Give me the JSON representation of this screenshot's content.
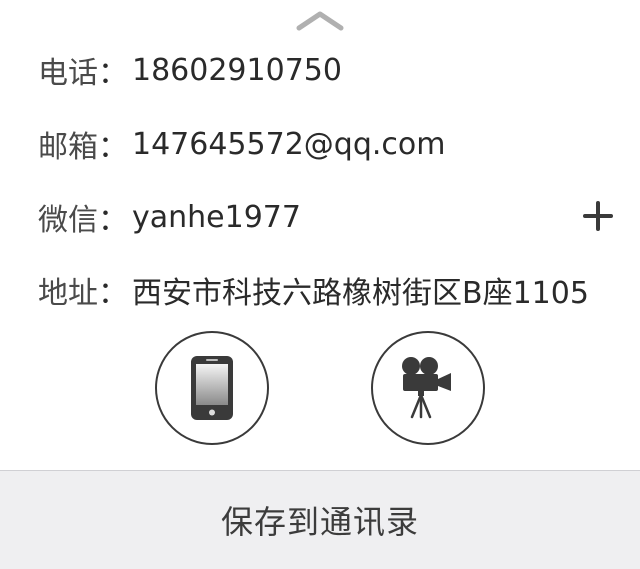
{
  "contact": {
    "phone": {
      "label": "电话",
      "sep": "：",
      "value": "18602910750"
    },
    "email": {
      "label": "邮箱",
      "sep": "：",
      "value": "147645572@qq.com"
    },
    "wechat": {
      "label": "微信",
      "sep": "：",
      "value": "yanhe1977"
    },
    "address": {
      "label": "地址",
      "sep": "：",
      "value": "西安市科技六路橡树街区B座1105"
    }
  },
  "icons": {
    "collapse": "chevron-up-icon",
    "add": "plus-icon",
    "phone": "mobile-phone-icon",
    "video": "video-camera-icon"
  },
  "footer": {
    "save_label": "保存到通讯录"
  },
  "colors": {
    "text": "#2a2a2a",
    "label": "#4a4a4a",
    "footer_bg": "#efeff1",
    "icon": "#3a3a3a",
    "chevron": "#b0b0b0"
  }
}
